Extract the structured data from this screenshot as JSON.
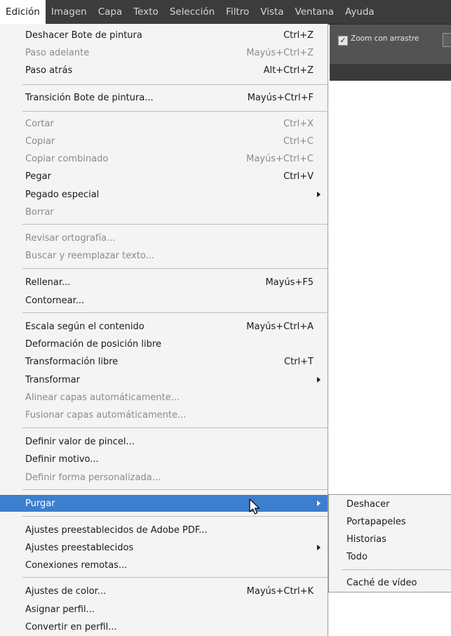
{
  "menubar": {
    "items": [
      {
        "label": "Edición",
        "active": true
      },
      {
        "label": "Imagen"
      },
      {
        "label": "Capa"
      },
      {
        "label": "Texto"
      },
      {
        "label": "Selección"
      },
      {
        "label": "Filtro"
      },
      {
        "label": "Vista"
      },
      {
        "label": "Ventana"
      },
      {
        "label": "Ayuda"
      }
    ]
  },
  "options_bar": {
    "checkbox_label": "Zoom con arrastre",
    "checked": true
  },
  "edit_menu": {
    "items": [
      {
        "label": "Deshacer Bote de pintura",
        "shortcut": "Ctrl+Z"
      },
      {
        "label": "Paso adelante",
        "shortcut": "Mayús+Ctrl+Z",
        "disabled": true
      },
      {
        "label": "Paso atrás",
        "shortcut": "Alt+Ctrl+Z"
      },
      {
        "label": "Transición Bote de pintura...",
        "shortcut": "Mayús+Ctrl+F"
      },
      {
        "label": "Cortar",
        "shortcut": "Ctrl+X",
        "disabled": true
      },
      {
        "label": "Copiar",
        "shortcut": "Ctrl+C",
        "disabled": true
      },
      {
        "label": "Copiar combinado",
        "shortcut": "Mayús+Ctrl+C",
        "disabled": true
      },
      {
        "label": "Pegar",
        "shortcut": "Ctrl+V"
      },
      {
        "label": "Pegado especial",
        "shortcut": "",
        "submenu": true
      },
      {
        "label": "Borrar",
        "shortcut": "",
        "disabled": true
      },
      {
        "label": "Revisar ortografía...",
        "shortcut": "",
        "disabled": true
      },
      {
        "label": "Buscar y reemplazar texto...",
        "shortcut": "",
        "disabled": true
      },
      {
        "label": "Rellenar...",
        "shortcut": "Mayús+F5"
      },
      {
        "label": "Contornear...",
        "shortcut": ""
      },
      {
        "label": "Escala según el contenido",
        "shortcut": "Mayús+Ctrl+A"
      },
      {
        "label": "Deformación de posición libre",
        "shortcut": ""
      },
      {
        "label": "Transformación libre",
        "shortcut": "Ctrl+T"
      },
      {
        "label": "Transformar",
        "shortcut": "",
        "submenu": true
      },
      {
        "label": "Alinear capas automáticamente...",
        "shortcut": "",
        "disabled": true
      },
      {
        "label": "Fusionar capas automáticamente...",
        "shortcut": "",
        "disabled": true
      },
      {
        "label": "Definir valor de pincel...",
        "shortcut": ""
      },
      {
        "label": "Definir motivo...",
        "shortcut": ""
      },
      {
        "label": "Definir forma personalizada...",
        "shortcut": "",
        "disabled": true
      },
      {
        "label": "Purgar",
        "shortcut": "",
        "submenu": true,
        "selected": true
      },
      {
        "label": "Ajustes preestablecidos de Adobe PDF...",
        "shortcut": ""
      },
      {
        "label": "Ajustes preestablecidos",
        "shortcut": "",
        "submenu": true
      },
      {
        "label": "Conexiones remotas...",
        "shortcut": ""
      },
      {
        "label": "Ajustes de color...",
        "shortcut": "Mayús+Ctrl+K"
      },
      {
        "label": "Asignar perfil...",
        "shortcut": ""
      },
      {
        "label": "Convertir en perfil...",
        "shortcut": ""
      }
    ]
  },
  "purgar_submenu": {
    "items": [
      {
        "label": "Deshacer"
      },
      {
        "label": "Portapapeles"
      },
      {
        "label": "Historias"
      },
      {
        "label": "Todo"
      },
      {
        "label": "Caché de vídeo"
      }
    ]
  },
  "colors": {
    "menubar_bg": "#3c3c3c",
    "menu_bg": "#f4f4f4",
    "highlight": "#3d7ecf",
    "disabled_text": "#8a8a8a"
  }
}
